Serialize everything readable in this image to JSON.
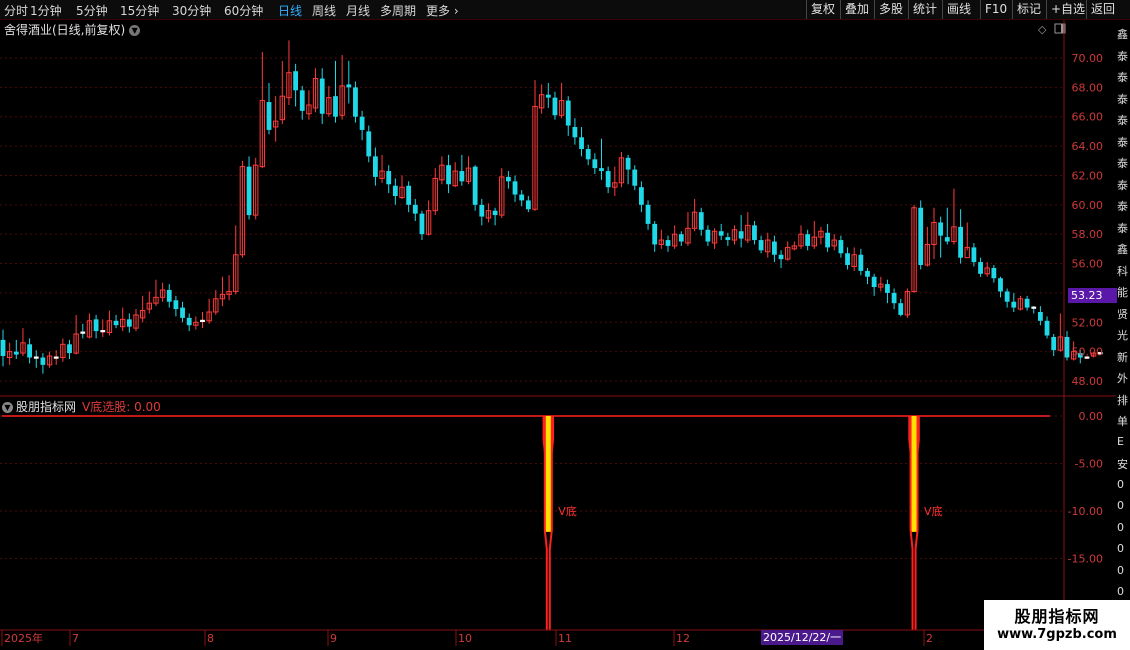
{
  "toolbar": {
    "periods": [
      "分时",
      "1分钟",
      "5分钟",
      "15分钟",
      "30分钟",
      "60分钟",
      "日线",
      "周线",
      "月线",
      "多周期",
      "更多"
    ],
    "active_period": "日线",
    "buttons": [
      "复权",
      "叠加",
      "多股",
      "统计",
      "画线",
      "F10",
      "标记",
      "+自选",
      "返回"
    ]
  },
  "chart": {
    "title": "舍得酒业(日线,前复权)",
    "current_price": "53.23",
    "y_ticks": [
      "70.00",
      "68.00",
      "66.00",
      "64.00",
      "62.00",
      "60.00",
      "58.00",
      "56.00",
      "54.00",
      "52.00",
      "50.00",
      "48.00"
    ]
  },
  "indicator": {
    "source": "股朋指标网",
    "name_value": "V底选股: 0.00",
    "signal_label": "V底",
    "y_ticks": [
      "0.00",
      "-5.00",
      "-10.00",
      "-15.00"
    ]
  },
  "x_axis": {
    "labels": [
      "2025年",
      "7",
      "8",
      "9",
      "10",
      "11",
      "12",
      "2"
    ],
    "cursor_date": "2025/12/22/一"
  },
  "right_strip": [
    "鑫",
    "泰",
    "泰",
    "泰",
    "泰",
    "泰",
    "泰",
    "泰",
    "泰",
    "泰",
    "鑫",
    "科",
    "能",
    "贤",
    "光",
    "新",
    "外",
    "排",
    "单",
    "E",
    "安",
    "0",
    "0",
    "0",
    "0",
    "0",
    "0",
    "0"
  ],
  "watermark": {
    "title": "股朋指标网",
    "url": "www.7gpzb.com"
  },
  "colors": {
    "up": "#ff3b3b",
    "down": "#1fd8e8",
    "grid": "#4a0a0a",
    "signal_fill": "#ffe000",
    "signal_line": "#ff2020",
    "accent": "#2fb0ff"
  },
  "chart_data": {
    "type": "candlestick",
    "ylim": [
      47,
      71.5
    ],
    "candles": [
      [
        50.8,
        49.7,
        51.5,
        49.0
      ],
      [
        49.6,
        50.0,
        50.6,
        49.1
      ],
      [
        50.0,
        49.8,
        50.8,
        49.5
      ],
      [
        49.9,
        50.6,
        51.6,
        49.7
      ],
      [
        50.5,
        49.6,
        50.9,
        49.2
      ],
      [
        49.6,
        49.5,
        50.1,
        48.9
      ],
      [
        49.6,
        49.1,
        49.9,
        48.5
      ],
      [
        49.1,
        49.7,
        50.0,
        48.9
      ],
      [
        49.6,
        49.6,
        50.1,
        49.1
      ],
      [
        49.6,
        50.5,
        50.9,
        49.3
      ],
      [
        50.5,
        49.9,
        50.8,
        49.5
      ],
      [
        49.9,
        51.2,
        52.5,
        49.8
      ],
      [
        51.3,
        51.2,
        51.9,
        50.9
      ],
      [
        51.0,
        52.1,
        52.6,
        50.9
      ],
      [
        52.2,
        51.4,
        52.5,
        50.9
      ],
      [
        51.4,
        51.4,
        52.2,
        51.0
      ],
      [
        51.3,
        52.1,
        52.8,
        51.1
      ],
      [
        52.1,
        51.8,
        52.5,
        51.6
      ],
      [
        51.7,
        52.2,
        53.0,
        51.4
      ],
      [
        52.2,
        51.7,
        52.6,
        51.3
      ],
      [
        51.6,
        52.5,
        52.9,
        51.4
      ],
      [
        52.3,
        52.8,
        53.8,
        52.0
      ],
      [
        52.9,
        53.3,
        54.1,
        52.6
      ],
      [
        53.3,
        53.7,
        54.9,
        53.1
      ],
      [
        53.7,
        54.2,
        54.7,
        53.4
      ],
      [
        54.2,
        53.4,
        54.6,
        53.0
      ],
      [
        53.5,
        52.9,
        53.8,
        52.4
      ],
      [
        53.0,
        52.3,
        53.4,
        52.0
      ],
      [
        52.3,
        51.8,
        52.6,
        51.4
      ],
      [
        51.8,
        52.0,
        52.4,
        51.5
      ],
      [
        52.0,
        52.1,
        52.7,
        51.6
      ],
      [
        52.1,
        52.7,
        53.6,
        51.9
      ],
      [
        52.7,
        53.6,
        54.2,
        52.5
      ],
      [
        53.6,
        53.9,
        55.1,
        53.1
      ],
      [
        53.9,
        54.1,
        55.2,
        53.5
      ],
      [
        54.1,
        56.6,
        58.6,
        53.9
      ],
      [
        56.6,
        62.6,
        63.0,
        56.4
      ],
      [
        62.6,
        59.3,
        63.3,
        59.0
      ],
      [
        59.3,
        62.7,
        63.2,
        59.0
      ],
      [
        62.6,
        67.1,
        70.4,
        62.5
      ],
      [
        67.0,
        65.1,
        68.3,
        64.8
      ],
      [
        65.3,
        65.7,
        67.4,
        64.3
      ],
      [
        65.8,
        67.4,
        69.8,
        65.5
      ],
      [
        67.3,
        69.0,
        71.2,
        66.8
      ],
      [
        69.1,
        67.8,
        69.6,
        66.7
      ],
      [
        67.8,
        66.4,
        68.1,
        65.8
      ],
      [
        66.2,
        66.8,
        67.8,
        65.8
      ],
      [
        66.6,
        68.6,
        69.3,
        66.3
      ],
      [
        68.6,
        66.2,
        69.3,
        65.5
      ],
      [
        66.2,
        67.3,
        68.1,
        66.0
      ],
      [
        67.4,
        66.0,
        69.8,
        65.6
      ],
      [
        66.1,
        68.1,
        70.2,
        65.8
      ],
      [
        68.2,
        68.0,
        69.8,
        66.9
      ],
      [
        68.0,
        66.0,
        68.4,
        65.6
      ],
      [
        66.0,
        65.1,
        66.4,
        64.4
      ],
      [
        65.0,
        63.3,
        65.4,
        62.9
      ],
      [
        63.3,
        61.9,
        63.9,
        61.3
      ],
      [
        61.8,
        62.3,
        63.4,
        61.5
      ],
      [
        62.3,
        61.4,
        62.7,
        60.8
      ],
      [
        61.3,
        60.6,
        61.8,
        60.0
      ],
      [
        60.5,
        61.2,
        62.0,
        60.4
      ],
      [
        61.3,
        60.0,
        61.6,
        59.5
      ],
      [
        60.0,
        59.4,
        60.4,
        58.9
      ],
      [
        59.4,
        58.0,
        59.6,
        57.6
      ],
      [
        58.0,
        59.6,
        60.3,
        57.9
      ],
      [
        59.6,
        61.8,
        62.5,
        59.3
      ],
      [
        61.7,
        62.7,
        63.3,
        61.4
      ],
      [
        62.7,
        61.4,
        63.4,
        60.8
      ],
      [
        61.3,
        62.3,
        62.9,
        61.2
      ],
      [
        62.3,
        61.6,
        63.4,
        61.3
      ],
      [
        61.6,
        62.5,
        63.3,
        61.4
      ],
      [
        62.6,
        60.0,
        62.7,
        59.6
      ],
      [
        60.0,
        59.2,
        60.4,
        58.6
      ],
      [
        59.1,
        59.6,
        60.1,
        58.8
      ],
      [
        59.6,
        59.3,
        59.8,
        58.6
      ],
      [
        59.3,
        61.9,
        62.5,
        59.1
      ],
      [
        61.9,
        61.6,
        62.3,
        61.1
      ],
      [
        61.6,
        60.7,
        62.0,
        60.2
      ],
      [
        60.7,
        60.3,
        61.0,
        59.9
      ],
      [
        60.3,
        59.7,
        60.6,
        59.5
      ],
      [
        59.7,
        66.7,
        68.5,
        59.6
      ],
      [
        66.6,
        67.5,
        68.2,
        66.2
      ],
      [
        67.5,
        67.3,
        68.3,
        66.6
      ],
      [
        67.3,
        66.1,
        67.7,
        65.8
      ],
      [
        66.1,
        67.1,
        68.3,
        65.9
      ],
      [
        67.1,
        65.4,
        67.4,
        64.7
      ],
      [
        65.3,
        64.6,
        65.9,
        64.1
      ],
      [
        64.6,
        63.8,
        65.3,
        63.3
      ],
      [
        63.8,
        63.1,
        64.1,
        62.7
      ],
      [
        63.1,
        62.5,
        63.5,
        62.1
      ],
      [
        62.5,
        62.3,
        64.5,
        61.7
      ],
      [
        62.3,
        61.2,
        62.6,
        60.8
      ],
      [
        61.2,
        61.5,
        62.6,
        60.6
      ],
      [
        61.5,
        63.2,
        63.6,
        61.2
      ],
      [
        63.2,
        62.4,
        63.4,
        61.4
      ],
      [
        62.4,
        61.3,
        62.7,
        61.0
      ],
      [
        61.2,
        60.0,
        61.6,
        59.5
      ],
      [
        60.0,
        58.7,
        60.3,
        58.3
      ],
      [
        58.7,
        57.3,
        58.9,
        56.8
      ],
      [
        57.3,
        57.6,
        58.3,
        57.0
      ],
      [
        57.6,
        57.2,
        57.9,
        56.8
      ],
      [
        57.2,
        58.0,
        58.6,
        57.0
      ],
      [
        58.0,
        57.5,
        58.2,
        57.2
      ],
      [
        57.4,
        58.4,
        59.5,
        57.2
      ],
      [
        58.4,
        59.5,
        60.4,
        58.2
      ],
      [
        59.5,
        58.3,
        59.8,
        57.9
      ],
      [
        58.3,
        57.5,
        58.6,
        57.2
      ],
      [
        57.4,
        58.2,
        58.4,
        57.0
      ],
      [
        58.2,
        57.9,
        58.7,
        57.6
      ],
      [
        57.8,
        57.6,
        58.1,
        57.2
      ],
      [
        57.6,
        58.3,
        58.6,
        57.3
      ],
      [
        58.2,
        57.7,
        59.3,
        57.1
      ],
      [
        57.6,
        58.6,
        59.5,
        57.4
      ],
      [
        58.6,
        57.6,
        58.9,
        57.3
      ],
      [
        57.6,
        56.9,
        57.9,
        56.7
      ],
      [
        56.8,
        57.6,
        58.1,
        56.4
      ],
      [
        57.5,
        56.6,
        57.9,
        56.1
      ],
      [
        56.6,
        56.3,
        56.9,
        55.7
      ],
      [
        56.3,
        57.1,
        57.5,
        56.2
      ],
      [
        57.0,
        57.2,
        57.5,
        56.9
      ],
      [
        57.2,
        58.0,
        58.6,
        57.0
      ],
      [
        58.0,
        57.2,
        58.3,
        56.9
      ],
      [
        57.2,
        57.8,
        58.9,
        57.0
      ],
      [
        57.8,
        58.2,
        58.5,
        57.3
      ],
      [
        58.1,
        57.1,
        58.7,
        56.8
      ],
      [
        57.2,
        57.6,
        58.0,
        56.9
      ],
      [
        57.6,
        56.7,
        57.9,
        56.4
      ],
      [
        56.7,
        55.9,
        57.1,
        55.6
      ],
      [
        55.8,
        56.6,
        57.1,
        55.5
      ],
      [
        56.6,
        55.5,
        57.0,
        55.2
      ],
      [
        55.5,
        55.1,
        55.7,
        54.6
      ],
      [
        55.1,
        54.4,
        55.3,
        53.8
      ],
      [
        54.4,
        54.6,
        55.1,
        54.1
      ],
      [
        54.6,
        54.0,
        54.9,
        53.3
      ],
      [
        54.0,
        53.3,
        54.3,
        52.9
      ],
      [
        53.3,
        52.5,
        53.6,
        52.4
      ],
      [
        52.5,
        54.1,
        54.3,
        52.3
      ],
      [
        54.1,
        59.8,
        60.0,
        54.0
      ],
      [
        59.8,
        55.9,
        60.3,
        55.6
      ],
      [
        55.9,
        57.3,
        58.5,
        55.8
      ],
      [
        57.3,
        58.8,
        59.8,
        56.3
      ],
      [
        58.8,
        57.9,
        59.2,
        56.4
      ],
      [
        57.8,
        57.5,
        59.8,
        57.3
      ],
      [
        57.5,
        58.5,
        61.1,
        57.3
      ],
      [
        58.5,
        56.4,
        59.7,
        56.0
      ],
      [
        56.4,
        57.1,
        58.8,
        56.9
      ],
      [
        57.1,
        56.1,
        57.4,
        55.8
      ],
      [
        56.1,
        55.3,
        56.4,
        55.1
      ],
      [
        55.3,
        55.7,
        56.1,
        55.1
      ],
      [
        55.7,
        55.0,
        55.9,
        54.7
      ],
      [
        55.0,
        54.1,
        55.1,
        53.7
      ],
      [
        54.1,
        53.4,
        54.3,
        53.0
      ],
      [
        53.4,
        53.0,
        54.0,
        52.7
      ],
      [
        52.9,
        53.6,
        53.8,
        52.8
      ],
      [
        53.6,
        53.0,
        53.8,
        52.8
      ],
      [
        53.0,
        52.9,
        53.1,
        52.6
      ],
      [
        52.7,
        52.1,
        53.1,
        51.8
      ],
      [
        52.1,
        51.1,
        52.4,
        50.9
      ],
      [
        51.0,
        50.1,
        51.2,
        49.7
      ],
      [
        50.1,
        51.0,
        52.6,
        50.0
      ],
      [
        51.0,
        49.6,
        51.4,
        49.4
      ],
      [
        49.5,
        50.0,
        50.7,
        49.4
      ],
      [
        49.9,
        49.6,
        50.1,
        49.2
      ],
      [
        49.6,
        49.6,
        49.7,
        49.5
      ],
      [
        49.7,
        49.9,
        50.0,
        49.6
      ],
      [
        49.9,
        49.9,
        49.9,
        49.8
      ]
    ],
    "signal_candle_indices": [
      82,
      137
    ]
  }
}
